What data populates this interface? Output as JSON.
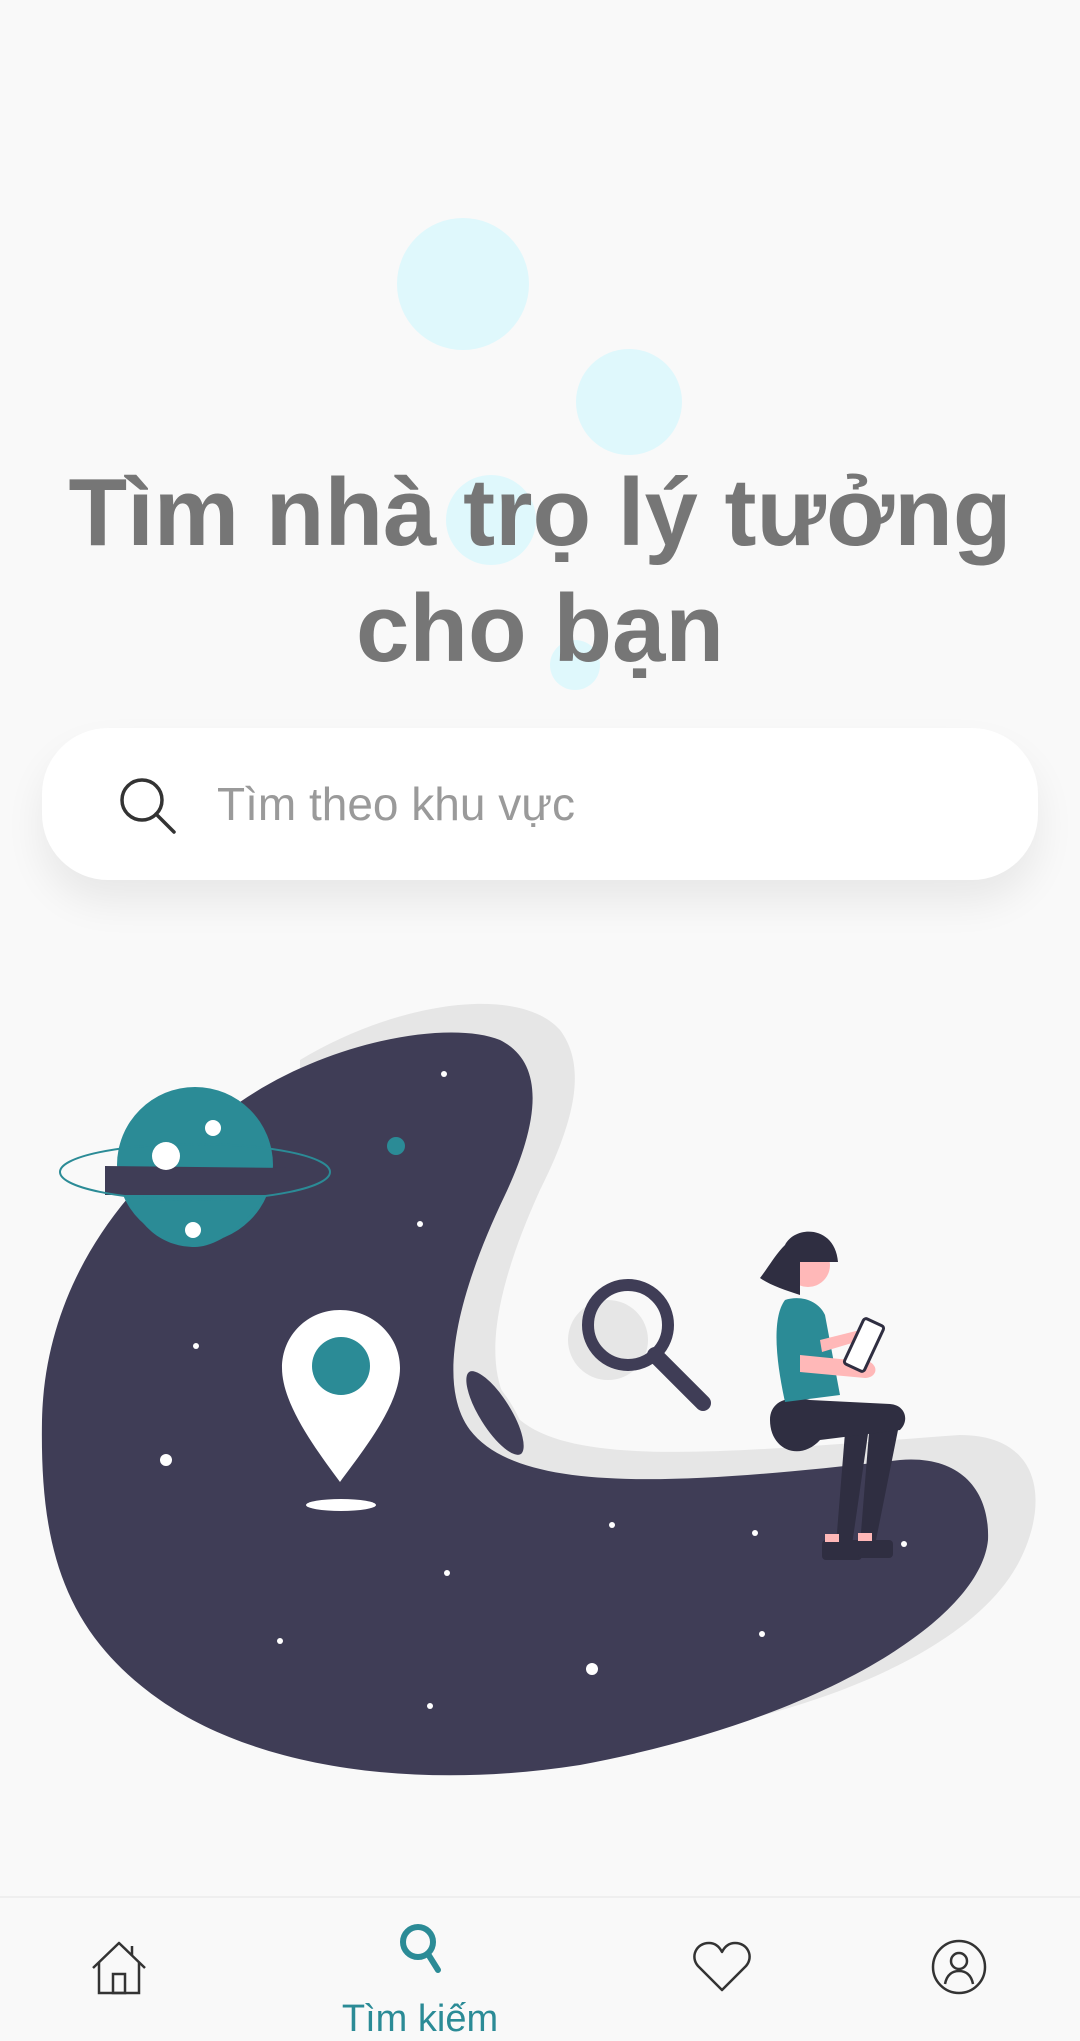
{
  "hero": {
    "title_line1": "Tìm nhà trọ lý tưởng",
    "title_line2": "cho bạn"
  },
  "search": {
    "placeholder": "Tìm theo khu vực",
    "icon": "search-icon"
  },
  "illustration": {
    "description_icon": "woman-searching-map-illustration"
  },
  "bottom_nav": {
    "items": [
      {
        "icon": "home-icon",
        "label": "",
        "active": false
      },
      {
        "icon": "search-icon",
        "label": "Tìm kiếm",
        "active": true
      },
      {
        "icon": "heart-icon",
        "label": "",
        "active": false
      },
      {
        "icon": "profile-icon",
        "label": "",
        "active": false
      }
    ],
    "active_color": "#2b8b96",
    "inactive_color": "#333333"
  },
  "colors": {
    "accent": "#2b8b96",
    "blob_dark": "#3f3d56",
    "bubble": "#dff8fc",
    "background": "#f9f9f9"
  }
}
